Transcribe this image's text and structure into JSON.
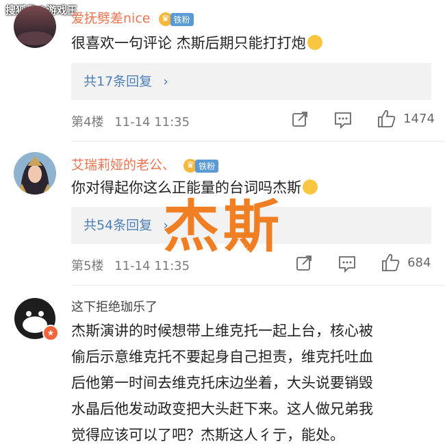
{
  "watermark": "搜狐号@游戏王",
  "overlay_text": "杰斯",
  "comments": [
    {
      "username": "爱抚劈差nice",
      "fan_badge": "铁粉",
      "text": "很喜欢一句评论 杰斯后期只能打打炮",
      "reply_count_label": "共17条回复",
      "floor": "第4楼",
      "time": "11-14 11:35",
      "likes": "1474"
    },
    {
      "username": "艾瑞莉娅的老公、",
      "fan_badge": "铁粉",
      "text": "你对得起你这么正能量的台词吗杰斯",
      "reply_count_label": "共54条回复",
      "floor": "第5楼",
      "time": "11-14 11:35",
      "likes": "684"
    },
    {
      "username": "这下拒绝珈乐了",
      "lines": [
        "杰斯演讲的时候想带上维克托一起上台，核心被",
        "偷后示意维克托不要起身自己担责，维克托吐血",
        "后他第一时间去维克托床边坐着，大头说要销毁",
        "水晶后他发动政变把大头赶下来。这人做兄弟我",
        "觉得应该可以了吧？杰斯这人彳亍，能处。"
      ]
    }
  ],
  "icons": {
    "share": "share-icon",
    "comment": "comment-icon",
    "like": "thumbs-up-icon",
    "chevron": "chevron-right-icon"
  }
}
